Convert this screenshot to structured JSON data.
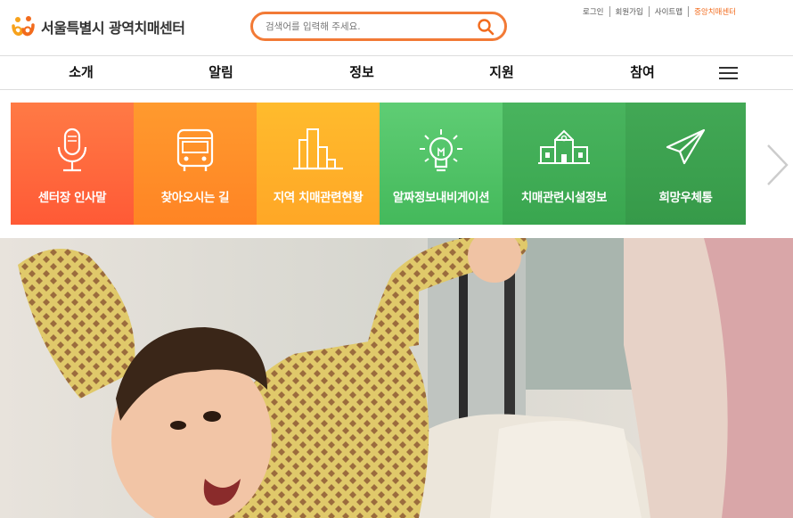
{
  "header": {
    "logo_text": "서울특별시 광역치매센터",
    "search": {
      "placeholder": "검색어를 입력해 주세요."
    },
    "util_links": [
      "로그인",
      "회원가입",
      "사이트맵",
      "중앙치매센터"
    ],
    "accent_color": "#f26b1d"
  },
  "nav": {
    "items": [
      "소개",
      "알림",
      "정보",
      "지원",
      "참여"
    ],
    "menu_icon": "hamburger-icon"
  },
  "quick_links": [
    {
      "label": "센터장 인사말",
      "icon": "microphone-icon",
      "color": "#ff6a3c"
    },
    {
      "label": "찾아오시는 길",
      "icon": "bus-icon",
      "color": "#ff8d28"
    },
    {
      "label": "지역 치매관련현황",
      "icon": "building-chart-icon",
      "color": "#ffb329"
    },
    {
      "label": "알짜정보내비게이션",
      "icon": "lightbulb-icon",
      "color": "#52c36a"
    },
    {
      "label": "치매관련시설정보",
      "icon": "school-building-icon",
      "color": "#3fae55"
    },
    {
      "label": "희망우체통",
      "icon": "paper-plane-icon",
      "color": "#3a9f4c"
    }
  ],
  "hero": {
    "image": "child-celebrating-with-grandparent-photo"
  }
}
